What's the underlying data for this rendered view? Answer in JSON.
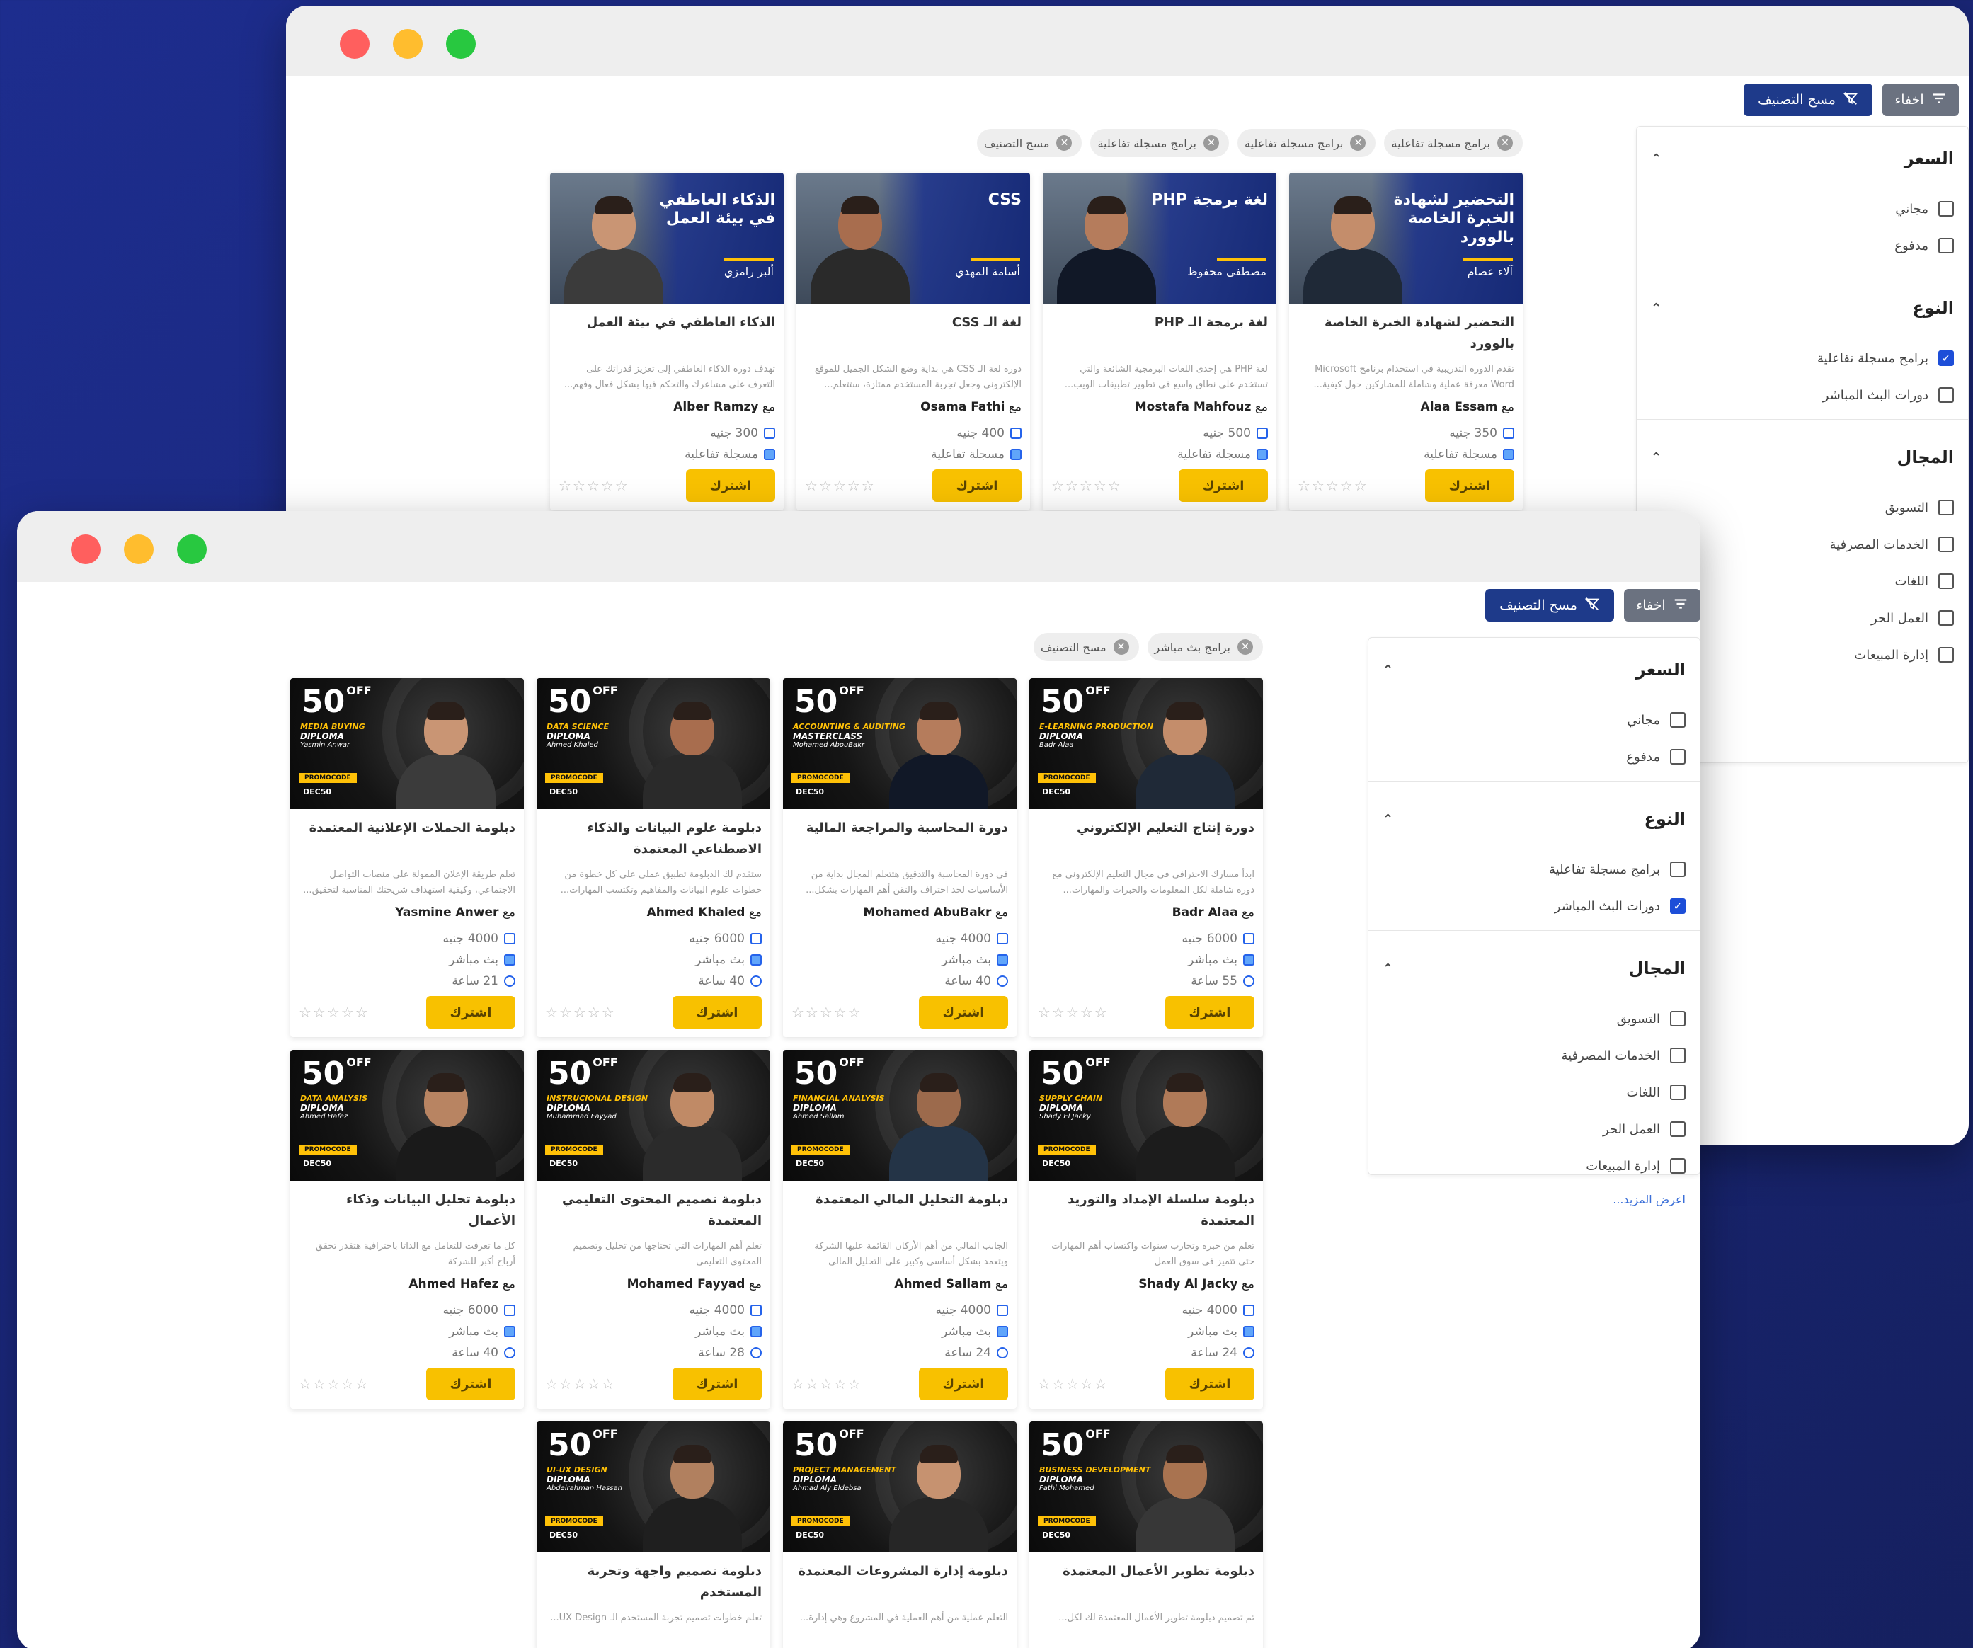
{
  "window_back": {
    "buttons": {
      "hide": "اخفاء",
      "clear": "مسح التصنيف"
    },
    "chips": [
      "برامج مسجلة تفاعلية",
      "برامج مسجلة تفاعلية",
      "برامج مسجلة تفاعلية",
      "مسح التصنيف"
    ],
    "filters": {
      "price": {
        "title": "السعر",
        "options": [
          {
            "label": "مجاني",
            "checked": false
          },
          {
            "label": "مدفوع",
            "checked": false
          }
        ]
      },
      "type": {
        "title": "النوع",
        "options": [
          {
            "label": "برامج مسجلة تفاعلية",
            "checked": true
          },
          {
            "label": "دورات البث المباشر",
            "checked": false
          }
        ]
      },
      "field": {
        "title": "المجال",
        "options": [
          {
            "label": "التسويق"
          },
          {
            "label": "الخدمات المصرفية"
          },
          {
            "label": "اللغات"
          },
          {
            "label": "العمل الحر"
          },
          {
            "label": "إدارة المبيعات"
          }
        ]
      }
    },
    "courses": [
      {
        "thumb_title": "التحضير لشهادة الخبرة الخاصة بالوورد",
        "thumb_instructor": "آلاء عصام",
        "title": "التحضير لشهادة الخبرة الخاصة بالوورد",
        "desc": "تقدم الدورة التدريبية في استخدام برنامج Microsoft Word معرفة عملية وشاملة للمشاركين حول كيفية...",
        "by": "مع",
        "instructor": "Alaa Essam",
        "price": "350 جنيه",
        "kind": "مسجلة تفاعلية",
        "buy": "اشترك",
        "stars": "☆☆☆☆☆"
      },
      {
        "thumb_title": "لغة برمجة PHP",
        "thumb_instructor": "مصطفى محفوظ",
        "title": "لغة برمجة الـ PHP",
        "desc": "لغة PHP هي إحدى اللغات البرمجية الشائعة والتي تستخدم على نطاق واسع في تطوير تطبيقات الويب...",
        "by": "مع",
        "instructor": "Mostafa Mahfouz",
        "price": "500 جنيه",
        "kind": "مسجلة تفاعلية",
        "buy": "اشترك",
        "stars": "☆☆☆☆☆"
      },
      {
        "thumb_title": "CSS",
        "thumb_instructor": "أسامة المهدي",
        "title": "لغة الـ CSS",
        "desc": "دورة لغة الـ CSS هي بداية وضع الشكل الجميل للموقع الإلكتروني وجعل تجربة المستخدم ممتازة، ستتعلم...",
        "by": "مع",
        "instructor": "Osama Fathi",
        "price": "400 جنيه",
        "kind": "مسجلة تفاعلية",
        "buy": "اشترك",
        "stars": "☆☆☆☆☆"
      },
      {
        "thumb_title": "الذكاء العاطفي في بيئة العمل",
        "thumb_instructor": "ألبر رامزي",
        "title": "الذكاء العاطفي في بيئة العمل",
        "desc": "تهدف دورة الذكاء العاطفي إلى تعزيز قدراتك على التعرف على مشاعرك والتحكم فيها بشكل فعال وفهم...",
        "by": "مع",
        "instructor": "Alber Ramzy",
        "price": "300 جنيه",
        "kind": "مسجلة تفاعلية",
        "buy": "اشترك",
        "stars": "☆☆☆☆☆"
      }
    ]
  },
  "window_front": {
    "buttons": {
      "hide": "اخفاء",
      "clear": "مسح التصنيف"
    },
    "chips": [
      "برامج بث مباشر",
      "مسح التصنيف"
    ],
    "filters": {
      "price": {
        "title": "السعر",
        "options": [
          {
            "label": "مجاني",
            "checked": false
          },
          {
            "label": "مدفوع",
            "checked": false
          }
        ]
      },
      "type": {
        "title": "النوع",
        "options": [
          {
            "label": "برامج مسجلة تفاعلية",
            "checked": false
          },
          {
            "label": "دورات البث المباشر",
            "checked": true
          }
        ]
      },
      "field": {
        "title": "المجال",
        "options": [
          {
            "label": "التسويق"
          },
          {
            "label": "الخدمات المصرفية"
          },
          {
            "label": "اللغات"
          },
          {
            "label": "العمل الحر"
          },
          {
            "label": "إدارة المبيعات"
          }
        ]
      },
      "more": "اعرض المزيد..."
    },
    "promo": {
      "big": "50",
      "off": "OFF",
      "code_label": "PROMOCODE",
      "code": "DEC50"
    },
    "courses": [
      {
        "d1": "E-LEARNING PRODUCTION",
        "d2": "DIPLOMA",
        "d3": "Badr Alaa",
        "title": "دورة إنتاج التعليم الإلكتروني",
        "desc": "ابدأ مسارك الاحترافي في مجال التعليم الإلكتروني مع دورة شاملة لكل المعلومات والخبرات والمهارات...",
        "by": "مع",
        "instructor": "Badr Alaa",
        "price": "6000 جنيه",
        "kind": "بث مباشر",
        "hours": "55 ساعة",
        "buy": "اشترك",
        "stars": "☆☆☆☆☆"
      },
      {
        "d1": "ACCOUNTING & AUDITING",
        "d2": "MASTERCLASS",
        "d3": "Mohamed AbouBakr",
        "title": "دورة المحاسبة والمراجعة المالية",
        "desc": "في دورة المحاسبة والتدقيق هتتعلم المجال بداية من الأساسيات لحد احتراف والتقن أهم المهارات بشكل...",
        "by": "مع",
        "instructor": "Mohamed AbuBakr",
        "price": "4000 جنيه",
        "kind": "بث مباشر",
        "hours": "40 ساعة",
        "buy": "اشترك",
        "stars": "☆☆☆☆☆"
      },
      {
        "d1": "DATA SCIENCE",
        "d2": "DIPLOMA",
        "d3": "Ahmed Khaled",
        "title": "دبلومة علوم البيانات والذكاء الاصطناعي المعتمدة",
        "desc": "ستقدم لك الدبلومة تطبيق عملي على كل خطوة من خطوات علوم البيانات والمفاهيم وتكتسب المهارات...",
        "by": "مع",
        "instructor": "Ahmed Khaled",
        "price": "6000 جنيه",
        "kind": "بث مباشر",
        "hours": "40 ساعة",
        "buy": "اشترك",
        "stars": "☆☆☆☆☆"
      },
      {
        "d1": "MEDIA BUYING",
        "d2": "DIPLOMA",
        "d3": "Yasmin Anwar",
        "title": "دبلومة الحملات الإعلانية المعتمدة",
        "desc": "تعلم طريقة الإعلان الممولة على منصات التواصل الاجتماعي، وكيفية استهداف شريحتك المناسبة لتحقيق...",
        "by": "مع",
        "instructor": "Yasmine Anwer",
        "price": "4000 جنيه",
        "kind": "بث مباشر",
        "hours": "21 ساعة",
        "buy": "اشترك",
        "stars": "☆☆☆☆☆"
      },
      {
        "d1": "SUPPLY CHAIN",
        "d2": "DIPLOMA",
        "d3": "Shady El Jacky",
        "title": "دبلومة سلسلة الإمداد والتوريد المعتمدة",
        "desc": "تعلم من خبرة وتجارب سنوات واكتساب أهم المهارات حتى تتميز في سوق العمل",
        "by": "مع",
        "instructor": "Shady Al Jacky",
        "price": "4000 جنيه",
        "kind": "بث مباشر",
        "hours": "24 ساعة",
        "buy": "اشترك",
        "stars": "☆☆☆☆☆"
      },
      {
        "d1": "FINANCIAL ANALYSIS",
        "d2": "DIPLOMA",
        "d3": "Ahmed Sallam",
        "title": "دبلومة التحليل المالي المعتمدة",
        "desc": "الجانب المالي من أهم الأركان القائمة عليها الشركة ويتعمد بشكل أساسي وكبير على التحليل المالي",
        "by": "مع",
        "instructor": "Ahmed Sallam",
        "price": "4000 جنيه",
        "kind": "بث مباشر",
        "hours": "24 ساعة",
        "buy": "اشترك",
        "stars": "☆☆☆☆☆"
      },
      {
        "d1": "INSTRUCIONAL DESIGN",
        "d2": "DIPLOMA",
        "d3": "Muhammad Fayyad",
        "title": "دبلومة تصميم المحتوى التعليمي المعتمدة",
        "desc": "تعلم أهم المهارات التي تحتاجها من تحليل وتصميم المحتوى التعليمي",
        "by": "مع",
        "instructor": "Mohamed Fayyad",
        "price": "4000 جنيه",
        "kind": "بث مباشر",
        "hours": "28 ساعة",
        "buy": "اشترك",
        "stars": "☆☆☆☆☆"
      },
      {
        "d1": "DATA ANALYSIS",
        "d2": "DIPLOMA",
        "d3": "Ahmed Hafez",
        "title": "دبلومة تحليل البيانات وذكاء الأعمال",
        "desc": "كل ما تعرفت للتعامل مع الداتا باحترافية هتقدر تحقق أرباح أكبر للشركة",
        "by": "مع",
        "instructor": "Ahmed Hafez",
        "price": "6000 جنيه",
        "kind": "بث مباشر",
        "hours": "40 ساعة",
        "buy": "اشترك",
        "stars": "☆☆☆☆☆"
      },
      {
        "d1": "BUSINESS DEVELOPMENT",
        "d2": "DIPLOMA",
        "d3": "Fathi Mohamed",
        "title": "دبلومة تطوير الأعمال المعتمدة",
        "desc": "تم تصميم دبلومة تطوير الأعمال المعتمدة لك لكل...",
        "by": "",
        "instructor": "",
        "price": "",
        "kind": "",
        "hours": "",
        "buy": "",
        "stars": ""
      },
      {
        "d1": "PROJECT MANAGEMENT",
        "d2": "DIPLOMA",
        "d3": "Ahmad Aly Eldebsa",
        "title": "دبلومة إدارة المشروعات المعتمدة",
        "desc": "التعلم عملية من أهم العملية في المشروع وهي إدارة...",
        "by": "",
        "instructor": "",
        "price": "",
        "kind": "",
        "hours": "",
        "buy": "",
        "stars": ""
      },
      {
        "d1": "UI-UX DESIGN",
        "d2": "DIPLOMA",
        "d3": "Abdelrahman Hassan",
        "title": "دبلومة تصميم واجهة وتجربة المستخدم",
        "desc": "تعلم خطوات تصميم تجربة المستخدم الـ UX Design...",
        "by": "",
        "instructor": "",
        "price": "",
        "kind": "",
        "hours": "",
        "buy": "",
        "stars": ""
      }
    ]
  }
}
